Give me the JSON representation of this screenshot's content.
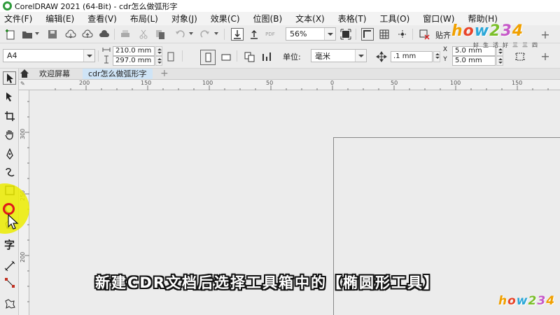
{
  "window": {
    "title": "CorelDRAW 2021 (64-Bit) - cdr怎么做弧形字"
  },
  "menu": [
    "文件(F)",
    "编辑(E)",
    "查看(V)",
    "布局(L)",
    "对象(J)",
    "效果(C)",
    "位图(B)",
    "文本(X)",
    "表格(T)",
    "工具(O)",
    "窗口(W)",
    "帮助(H)"
  ],
  "toolbar": {
    "zoom": "56%",
    "snap_label": "贴齐",
    "pdf_label": "PDF",
    "page_size": "A4",
    "width": "210.0 mm",
    "height": "297.0 mm",
    "units_label": "单位:",
    "units_value": "毫米",
    "nudge": ".1 mm",
    "dup_x": "5.0 mm",
    "dup_y": "5.0 mm",
    "dup_x_label": "X",
    "dup_y_label": "Y"
  },
  "tabs": {
    "welcome": "欢迎屏幕",
    "document": "cdr怎么做弧形字"
  },
  "ruler": {
    "h_labels": [
      "200",
      "150",
      "100",
      "50",
      "0",
      "50",
      "100",
      "150"
    ],
    "v_labels": [
      "300",
      "250",
      "200"
    ],
    "corner": "✎"
  },
  "toolbox": {
    "text_tool": "字"
  },
  "caption": "新建CDR文档后选择工具箱中的【椭圆形工具】",
  "watermark": {
    "letters": [
      "h",
      "o",
      "w",
      "2",
      "3",
      "4"
    ],
    "sub": "好生活好三三四"
  }
}
